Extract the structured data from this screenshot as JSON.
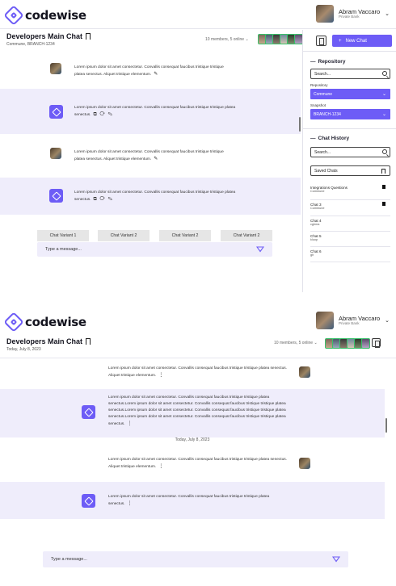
{
  "app": {
    "logo_text": "codewise"
  },
  "user": {
    "name": "Abram Vaccaro",
    "subtitle": "Private Bank"
  },
  "colors": {
    "accent": "#6d5cf6",
    "bot_row_bg": "#efedfb",
    "online": "#39c06a"
  },
  "top_view": {
    "chat_title": "Developers Main Chat",
    "chat_subtitle": "Commune, BRANCH-1234",
    "members_text": "10 members, 5 online",
    "messages": [
      {
        "role": "user",
        "text": "Lorem ipsum dolor sit amet consectetur. Convallis consequat faucibus tristique tristique platea senectus. Aliquet tristique elementum."
      },
      {
        "role": "bot",
        "text": "Lorem ipsum dolor sit amet consectetur. Convallis consequat faucibus tristique tristique platea senectus."
      },
      {
        "role": "user",
        "text": "Lorem ipsum dolor sit amet consectetur. Convallis consequat faucibus tristique tristique platea senectus. Aliquet tristique elementum."
      },
      {
        "role": "bot",
        "text": "Lorem ipsum dolor sit amet consectetur. Convallis consequat faucibus tristique tristique platea senectus."
      }
    ],
    "variants": [
      "Chat Variant 1",
      "Chat Variant 2",
      "Chat Variant 2",
      "Chat Variant 2"
    ],
    "input_placeholder": "Type a message..."
  },
  "right_panel": {
    "new_chat_label": "New Chat",
    "repository_heading": "Repository",
    "search_placeholder": "Search...",
    "repository_label": "Repository",
    "repository_value": "Commune",
    "snapshot_label": "Snapshot",
    "snapshot_value": "BRANCH-1234",
    "history_heading": "Chat History",
    "saved_chats_label": "Saved Chats",
    "history": [
      {
        "title": "Integrations Questions",
        "sub": "Commune",
        "saved": true
      },
      {
        "title": "Chat 3",
        "sub": "Commune",
        "saved": true
      },
      {
        "title": "Chat 4",
        "sub": "cghma",
        "saved": false
      },
      {
        "title": "Chat 5",
        "sub": "kluop",
        "saved": false
      },
      {
        "title": "Chat 6",
        "sub": "gh",
        "saved": false
      }
    ]
  },
  "bottom_view": {
    "chat_title": "Developers Main Chat",
    "chat_subtitle": "Today, July 8, 2023",
    "members_text": "10 members, 5 online",
    "date_divider": "Today, July 8, 2023",
    "messages": [
      {
        "role": "user",
        "text": "Lorem ipsum dolor sit amet consectetur. Convallis consequat faucibus tristique tristique platea senectus. Aliquet tristique elementum."
      },
      {
        "role": "bot",
        "text": "Lorem ipsum dolor sit amet consectetur. Convallis consequat faucibus tristique tristique platea senectus.Lorem ipsum dolor sit amet consectetur. Convallis consequat faucibus tristique tristique platea senectus.Lorem ipsum dolor sit amet consectetur. Convallis consequat faucibus tristique tristique platea senectus.Lorem ipsum dolor sit amet consectetur. Convallis consequat faucibus tristique tristique platea senectus."
      },
      {
        "role": "user",
        "text": "Lorem ipsum dolor sit amet consectetur. Convallis consequat faucibus tristique tristique platea senectus. Aliquet tristique elementum."
      },
      {
        "role": "bot",
        "text": "Lorem ipsum dolor sit amet consectetur. Convallis consequat faucibus tristique tristique platea senectus."
      }
    ],
    "input_placeholder": "Type a message..."
  }
}
